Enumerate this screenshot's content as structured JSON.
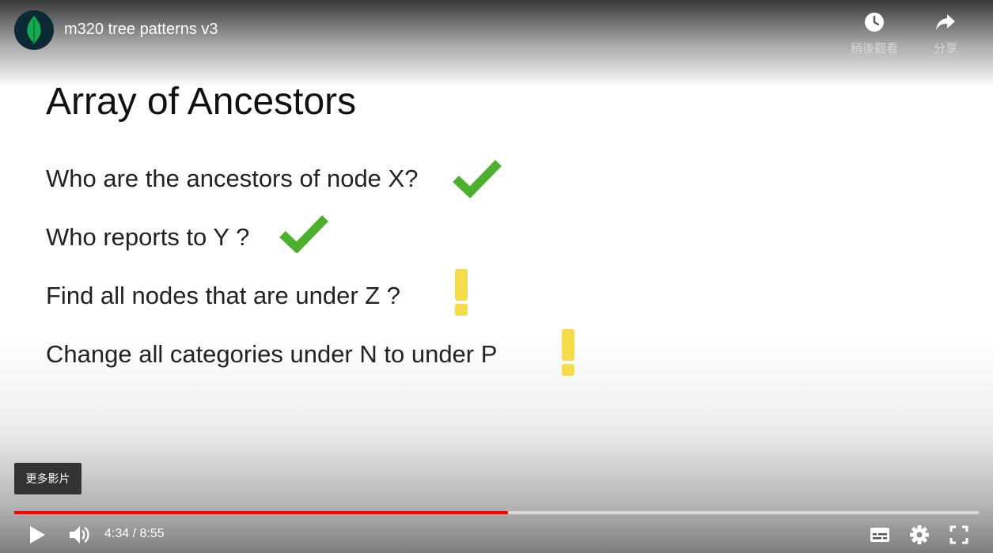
{
  "video": {
    "title": "m320 tree patterns v3"
  },
  "top_actions": {
    "watch_later_label": "稍後觀看",
    "share_label": "分享"
  },
  "slide": {
    "title": "Array of Ancestors",
    "questions": [
      {
        "text": "Who are the ancestors of node X?",
        "status": "check"
      },
      {
        "text": "Who reports to Y ?",
        "status": "check"
      },
      {
        "text": "Find all nodes that are under Z ?",
        "status": "exclamation"
      },
      {
        "text": "Change all categories under N to under P",
        "status": "exclamation"
      }
    ]
  },
  "more_videos_label": "更多影片",
  "playback": {
    "current_time": "4:34",
    "duration": "8:55",
    "time_display": "4:34 / 8:55",
    "progress_fraction": 0.512
  },
  "colors": {
    "progress": "#ff0000",
    "check": "#4caf2e",
    "exclamation": "#f5dc4a",
    "avatar_bg": "#0b2a33",
    "leaf": "#13aa52"
  },
  "icons": [
    "mongodb-leaf-icon",
    "clock-icon",
    "share-arrow-icon",
    "play-icon",
    "volume-icon",
    "subtitles-icon",
    "gear-icon",
    "fullscreen-icon",
    "checkmark-icon",
    "exclamation-icon"
  ]
}
